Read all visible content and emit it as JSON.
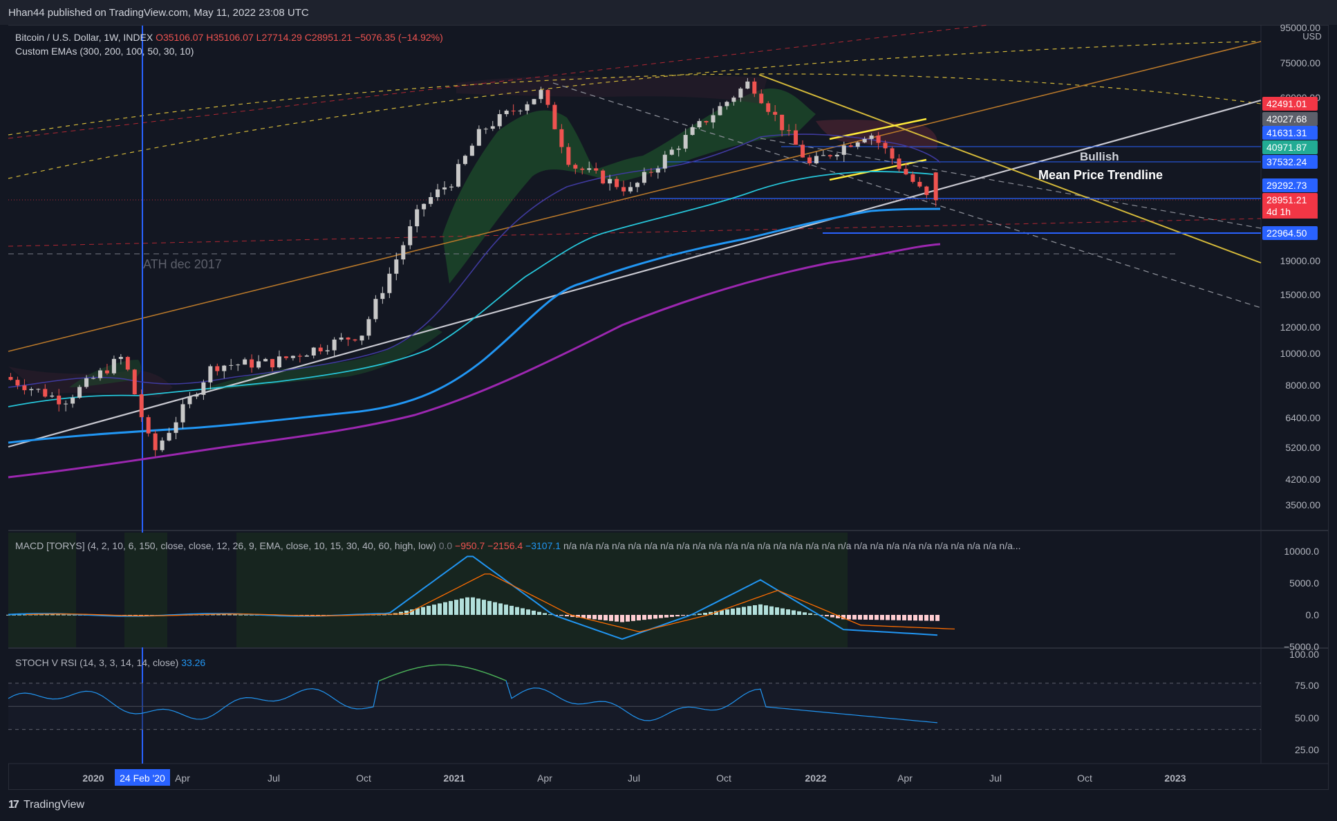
{
  "header": {
    "published": "Hhan44 published on TradingView.com, May 11, 2022 23:08 UTC"
  },
  "legend": {
    "symbol": "Bitcoin / U.S. Dollar, 1W, INDEX",
    "open": "O35106.07",
    "high": "H35106.07",
    "low": "L27714.29",
    "close": "C28951.21",
    "change": "−5076.35 (−14.92%)",
    "emas": "Custom EMAs (300, 200, 100, 50, 30, 10)"
  },
  "macd_legend": {
    "label": "MACD [TORYS] (4, 2, 10, 6, 150, close, close, 12, 26, 9, EMA, close, 10, 15, 30, 40, 60, high, low)",
    "v1": "0.0",
    "v2": "−950.7",
    "v3": "−2156.4",
    "v4": "−3107.1",
    "rest": "n/a n/a n/a n/a n/a n/a n/a n/a n/a n/a n/a n/a n/a n/a n/a n/a n/a n/a n/a n/a n/a n/a n/a n/a n/a n/a n/a n/a..."
  },
  "stoch_legend": {
    "label": "STOCH V RSI (14, 3, 3, 14, 14, close)",
    "value": "33.26"
  },
  "annotations": {
    "ath": "ATH dec 2017",
    "bullish": "Bullish",
    "trendline": "Mean Price Trendline"
  },
  "price_axis": {
    "currency": "USD",
    "ticks": [
      "95000.00",
      "75000.00",
      "60000.00",
      "19000.00",
      "15000.00",
      "12000.00",
      "10000.00",
      "8000.00",
      "6400.00",
      "5200.00",
      "4200.00",
      "3500.00"
    ],
    "tags": [
      {
        "text": "42491.01",
        "color": "#f23645"
      },
      {
        "text": "42027.68",
        "color": "#5d606b"
      },
      {
        "text": "41631.31",
        "color": "#2962ff"
      },
      {
        "text": "40971.87",
        "color": "#22ab94"
      },
      {
        "text": "37532.24",
        "color": "#2962ff"
      },
      {
        "text": "29292.73",
        "color": "#2962ff"
      },
      {
        "text": "28951.21",
        "color": "#f23645"
      },
      {
        "text": "4d 1h",
        "color": "#f23645"
      },
      {
        "text": "22964.50",
        "color": "#2962ff"
      }
    ]
  },
  "macd_axis": [
    "10000.0",
    "5000.0",
    "0.0",
    "−5000.0"
  ],
  "stoch_axis": [
    "100.00",
    "75.00",
    "50.00",
    "25.00"
  ],
  "time_axis": [
    "2020",
    "24 Feb '20",
    "Apr",
    "Jul",
    "Oct",
    "2021",
    "Apr",
    "Jul",
    "Oct",
    "2022",
    "Apr",
    "Jul",
    "Oct",
    "2023"
  ],
  "footer": {
    "logo": "17",
    "brand": "TradingView"
  },
  "chart_data": {
    "type": "candlestick",
    "title": "Bitcoin / U.S. Dollar, 1W, INDEX",
    "y_scale": "log",
    "ylim": [
      3200,
      95000
    ],
    "weekly_close_path": [
      {
        "x": "2019-10",
        "y": 8500
      },
      {
        "x": "2019-12",
        "y": 7200
      },
      {
        "x": "2020-02",
        "y": 9800
      },
      {
        "x": "2020-03",
        "y": 5000
      },
      {
        "x": "2020-05",
        "y": 9200
      },
      {
        "x": "2020-07",
        "y": 9400
      },
      {
        "x": "2020-10",
        "y": 11500
      },
      {
        "x": "2020-11",
        "y": 18000
      },
      {
        "x": "2020-12",
        "y": 28000
      },
      {
        "x": "2021-01",
        "y": 33000
      },
      {
        "x": "2021-02",
        "y": 47000
      },
      {
        "x": "2021-04",
        "y": 61000
      },
      {
        "x": "2021-05",
        "y": 37000
      },
      {
        "x": "2021-07",
        "y": 31000
      },
      {
        "x": "2021-09",
        "y": 46000
      },
      {
        "x": "2021-11",
        "y": 66000
      },
      {
        "x": "2022-01",
        "y": 37000
      },
      {
        "x": "2022-03",
        "y": 46500
      },
      {
        "x": "2022-05",
        "y": 28951
      }
    ],
    "ema_values": {
      "EMA300": 22964.5,
      "EMA200": 29292.73,
      "EMA100": 37532.24,
      "EMA50": 40971.87,
      "EMA30": 41631.31,
      "EMA10": 42027.68
    },
    "last_close": 28951.21,
    "macd_last": -3107.1,
    "stoch_rsi_last": 33.26
  },
  "colors": {
    "up": "#c8c8c8",
    "down": "#ef5350",
    "ema300": "#9c27b0",
    "ema200": "#2196f3",
    "ema100": "#26c6da",
    "trend_white": "#c8c8d0",
    "trend_orange": "#b8782a",
    "trend_yellow": "#d4b93a",
    "cross_line": "#2962ff"
  }
}
